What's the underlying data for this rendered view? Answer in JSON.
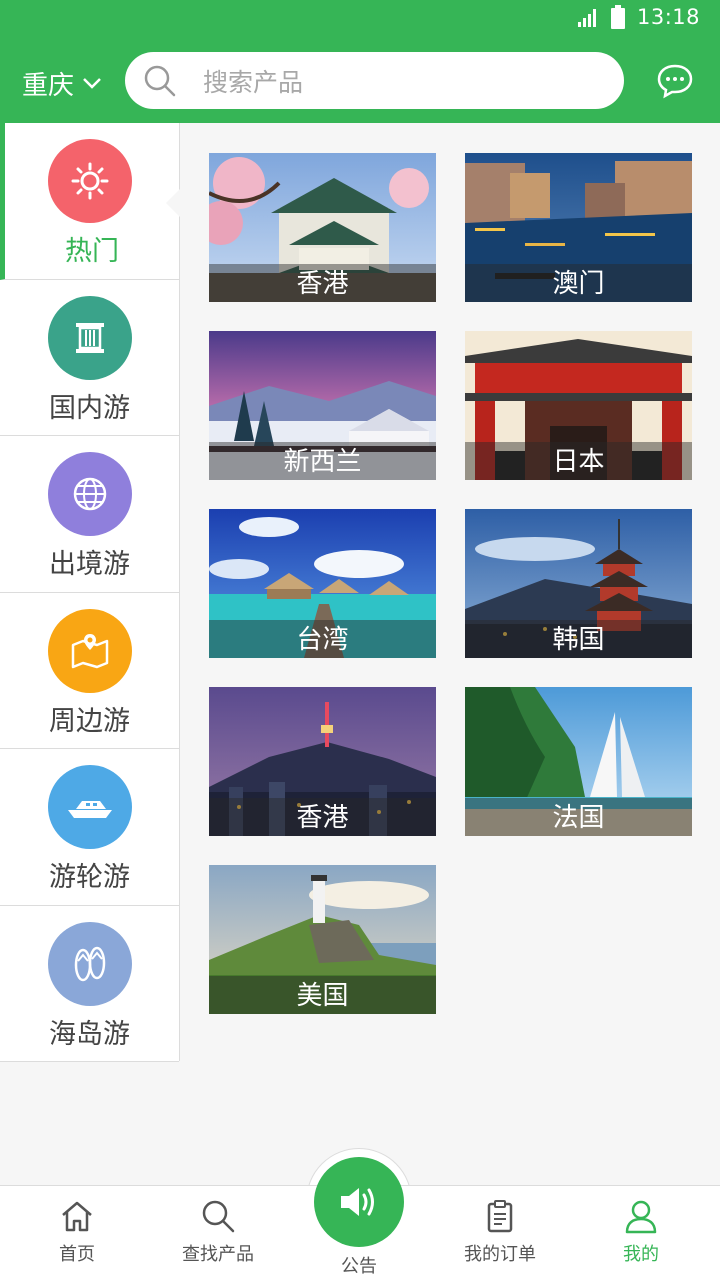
{
  "status_bar": {
    "time": "13:18"
  },
  "header": {
    "city": "重庆",
    "search_placeholder": "搜索产品"
  },
  "sidebar": {
    "items": [
      {
        "label": "热门",
        "icon": "sun-icon",
        "color": "#f4636b",
        "active": true
      },
      {
        "label": "国内游",
        "icon": "pillar-icon",
        "color": "#3aa38a",
        "active": false
      },
      {
        "label": "出境游",
        "icon": "globe-icon",
        "color": "#8f7fdc",
        "active": false
      },
      {
        "label": "周边游",
        "icon": "map-icon",
        "color": "#f9a614",
        "active": false
      },
      {
        "label": "游轮游",
        "icon": "yacht-icon",
        "color": "#4ea9e6",
        "active": false
      },
      {
        "label": "海岛游",
        "icon": "flipflops-icon",
        "color": "#8aa7d8",
        "active": false
      }
    ]
  },
  "destinations": [
    {
      "label": "香港"
    },
    {
      "label": "澳门"
    },
    {
      "label": "新西兰"
    },
    {
      "label": "日本"
    },
    {
      "label": "台湾"
    },
    {
      "label": "韩国"
    },
    {
      "label": "香港"
    },
    {
      "label": "法国"
    },
    {
      "label": "美国"
    }
  ],
  "tabbar": {
    "home": "首页",
    "search": "查找产品",
    "notice": "公告",
    "orders": "我的订单",
    "mine": "我的"
  },
  "colors": {
    "accent": "#36b556"
  }
}
